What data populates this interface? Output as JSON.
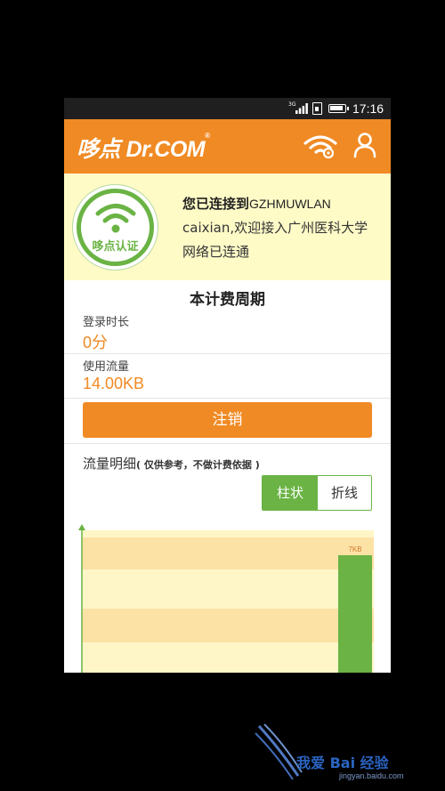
{
  "status_bar": {
    "network": "3G",
    "time": "17:16"
  },
  "header": {
    "logo_text": "哆点 Dr.COM",
    "logo_mark": "®"
  },
  "connection": {
    "badge_label": "哆点认证",
    "line1_prefix": "您已连接到",
    "ssid": "GZHMUWLAN",
    "line2": "caixian,欢迎接入广州医科大学",
    "line3": "网络已连通"
  },
  "billing": {
    "title": "本计费周期",
    "login_time_label": "登录时长",
    "login_time_value": "0分",
    "traffic_label": "使用流量",
    "traffic_value": "14.00KB",
    "logout_label": "注销"
  },
  "flow": {
    "title": "流量明细",
    "note": "( 仅供参考，不做计费依据 )",
    "toggle_bar": "柱状",
    "toggle_line": "折线"
  },
  "chart_data": {
    "type": "bar",
    "data_labels": [
      "7KB"
    ],
    "values_kb": [
      7
    ],
    "colors": {
      "bar": "#6ab344",
      "band_dark": "#fde2a6",
      "band_light": "#fff6c8",
      "axis": "#6ab344"
    }
  },
  "watermark": {
    "text": "我爱 Bai 经验",
    "url": "jingyan.baidu.com"
  },
  "colors": {
    "accent": "#f08a24",
    "green": "#6ab344",
    "panel": "#fffbc7"
  }
}
